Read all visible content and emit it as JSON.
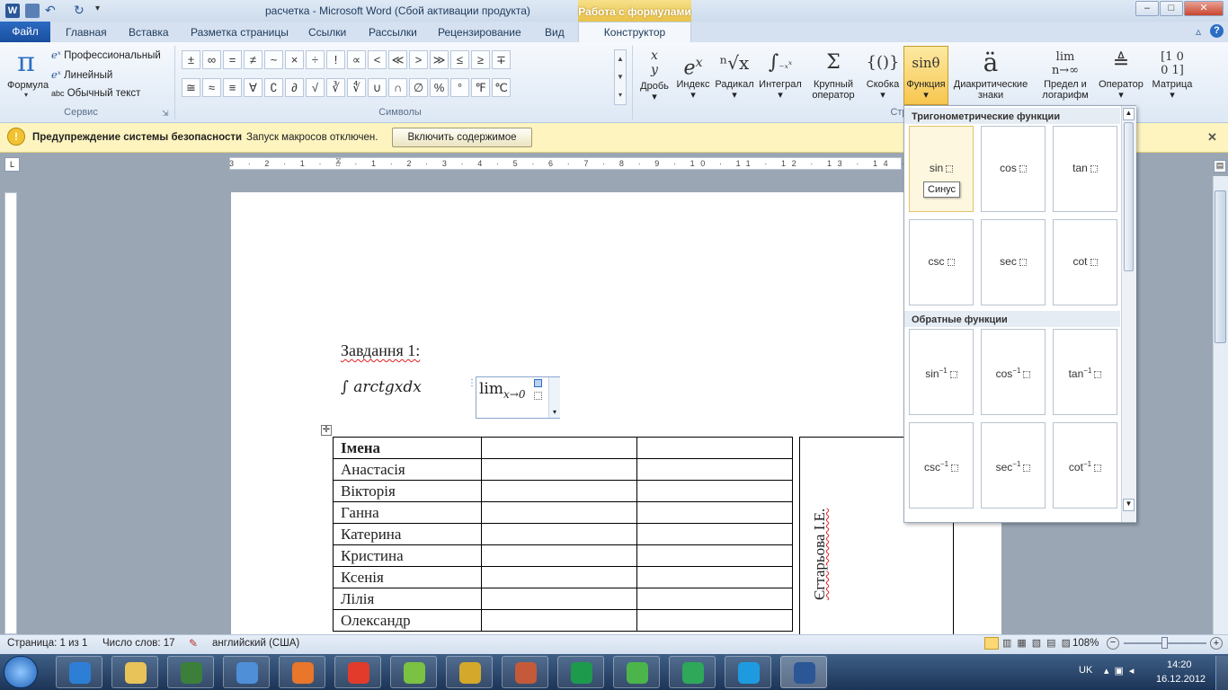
{
  "window": {
    "title": "расчетка  -  Microsoft Word (Сбой активации продукта)",
    "context_group": "Работа с формулами",
    "controls": [
      "–",
      "□",
      "✕"
    ]
  },
  "tabs": {
    "file": "Файл",
    "items": [
      "Главная",
      "Вставка",
      "Разметка страницы",
      "Ссылки",
      "Рассылки",
      "Рецензирование",
      "Вид"
    ],
    "constructor": "Конструктор"
  },
  "ribbon": {
    "service": {
      "formula_label": "Формула",
      "professional": "Профессиональный",
      "linear": "Линейный",
      "plain_text": "Обычный текст",
      "group_label": "Сервис"
    },
    "symbols": {
      "row1": [
        "±",
        "∞",
        "=",
        "≠",
        "~",
        "×",
        "÷",
        "!",
        "∝",
        "<",
        "≪",
        ">",
        "≫",
        "≤",
        "≥",
        "∓"
      ],
      "row2": [
        "≅",
        "≈",
        "≡",
        "∀",
        "∁",
        "∂",
        "√",
        "∛",
        "∜",
        "∪",
        "∩",
        "∅",
        "%",
        "°",
        "℉",
        "℃"
      ],
      "group_label": "Символы"
    },
    "structures": [
      {
        "glyph": "x/y",
        "label": "Дробь"
      },
      {
        "glyph": "eˣ",
        "label": "Индекс"
      },
      {
        "glyph": "ⁿ√x",
        "label": "Радикал"
      },
      {
        "glyph": "∫",
        "label": "Интеграл"
      },
      {
        "glyph": "Σ",
        "label": "Крупный оператор"
      },
      {
        "glyph": "{()}",
        "label": "Скобка"
      },
      {
        "glyph": "sinθ",
        "label": "Функция"
      },
      {
        "glyph": "ä",
        "label": "Диакритические знаки"
      },
      {
        "glyph": "lim n→∞",
        "label": "Предел и логарифм"
      },
      {
        "glyph": "≜",
        "label": "Оператор"
      },
      {
        "glyph": "[10 01]",
        "label": "Матрица"
      }
    ],
    "structures_group_label": "Стр"
  },
  "security_bar": {
    "title": "Предупреждение системы безопасности",
    "message": "Запуск макросов отключен.",
    "button": "Включить содержимое"
  },
  "gallery": {
    "section1": "Тригонометрические функции",
    "trig": [
      "sin",
      "cos",
      "tan",
      "csc",
      "sec",
      "cot"
    ],
    "tooltip": "Синус",
    "section2": "Обратные функции",
    "inverse": [
      "sin",
      "cos",
      "tan",
      "csc",
      "sec",
      "cot"
    ],
    "inverse_sup": "−1"
  },
  "document": {
    "heading": "Завдання 1:",
    "integral": "∫ arctgxdx",
    "limit": "lim",
    "limit_sub": "x→0",
    "table_header": "Імена",
    "names": [
      "Анастасія",
      "Вікторія",
      "Ганна",
      "Катерина",
      "Кристина",
      "Ксенія",
      "Лілія",
      "Олександр"
    ],
    "rotated_text": "Єгтарьова І.Е."
  },
  "statusbar": {
    "page": "Страница: 1 из 1",
    "words": "Число слов: 17",
    "language": "английский (США)",
    "zoom": "108%"
  },
  "taskbar": {
    "lang": "UK",
    "time": "14:20",
    "date": "16.12.2012"
  }
}
